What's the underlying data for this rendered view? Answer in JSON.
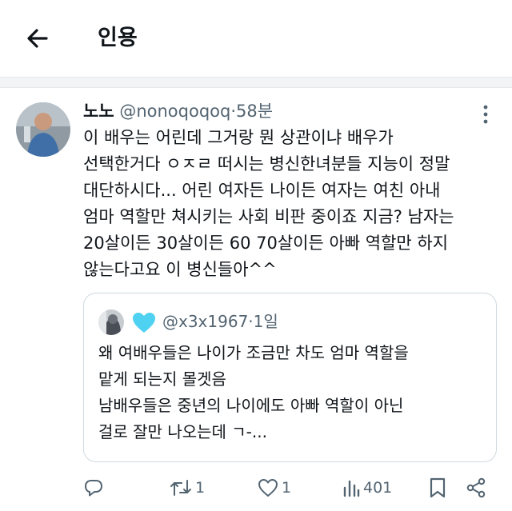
{
  "header": {
    "title": "인용",
    "back_icon": "arrow-left-icon"
  },
  "tweet": {
    "name": "노노",
    "handle": "@nonoqoqoq",
    "dot": "·",
    "time": "58분",
    "lines": [
      "이 배우는 어린데 그거랑 뭔 상관이냐 배우가",
      "선택한거다 ㅇㅈㄹ 떠시는 병신한녀분들 지능이 정말",
      "대단하시다... 어린 여자든 나이든 여자는 여친 아내",
      "엄마 역할만 쳐시키는 사회 비판 중이죠 지금? 남자는",
      "20살이든 30살이든 60 70살이든 아빠 역할만 하지",
      "않는다고요 이 병신들아^^"
    ]
  },
  "quote": {
    "handle": "@x3x1967",
    "dot": "·",
    "time": "1일",
    "lines": [
      "왜 여배우들은 나이가 조금만 차도 엄마 역할을",
      "맡게 되는지 몰겟음",
      "남배우들은 중년의 나이에도 아빠 역할이 아닌",
      "걸로 잘만 나오는데 ㄱ-..."
    ]
  },
  "actions": {
    "reply_count": "",
    "retweet_count": "1",
    "like_count": "1",
    "view_count": "401"
  },
  "colors": {
    "text": "#0f1419",
    "muted": "#536471",
    "border": "#cfd9de",
    "heart": "#4fd1f2"
  }
}
